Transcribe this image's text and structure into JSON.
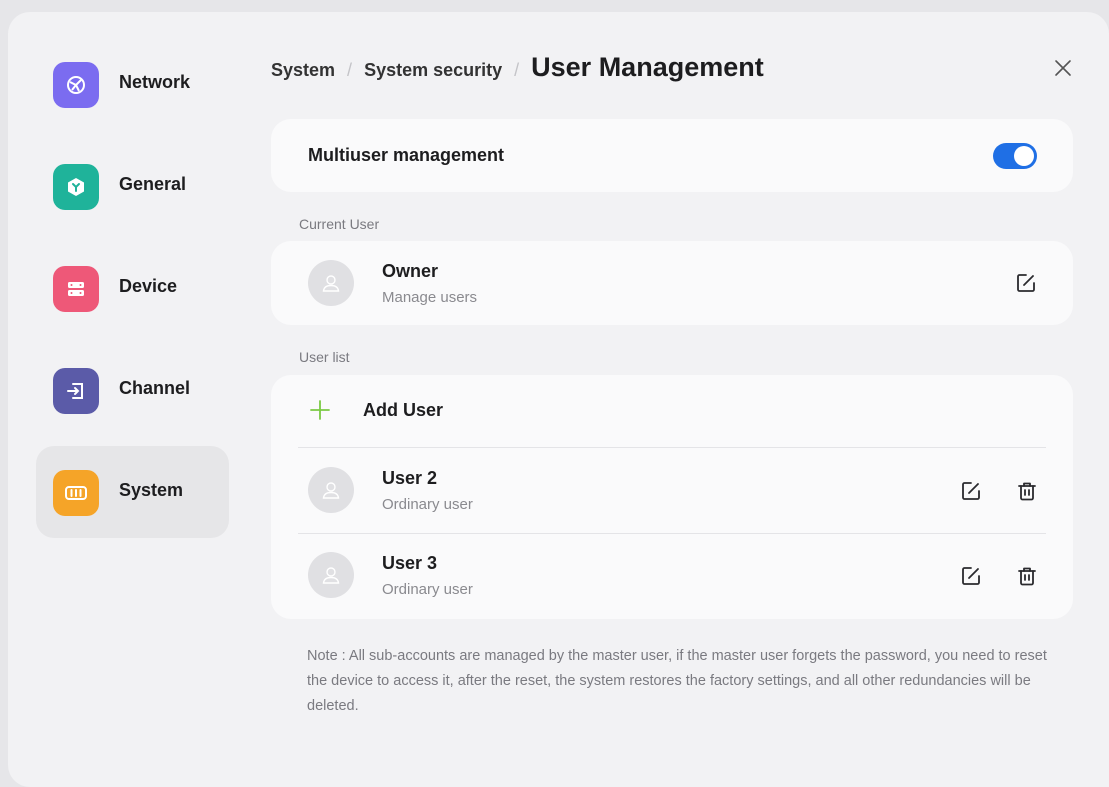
{
  "sidebar": {
    "items": [
      {
        "label": "Network",
        "icon": "network-icon",
        "color": "#7b6cf0"
      },
      {
        "label": "General",
        "icon": "general-icon",
        "color": "#1fb39a"
      },
      {
        "label": "Device",
        "icon": "device-icon",
        "color": "#ee5878"
      },
      {
        "label": "Channel",
        "icon": "channel-icon",
        "color": "#5b5ba8"
      },
      {
        "label": "System",
        "icon": "system-icon",
        "color": "#f5a428",
        "active": true
      }
    ]
  },
  "header": {
    "breadcrumb": [
      "System",
      "System security"
    ],
    "separator": "/",
    "title": "User Management"
  },
  "multiuser": {
    "label": "Multiuser management",
    "enabled": true,
    "toggle_color": "#1f6fe5"
  },
  "current_user": {
    "section_label": "Current User",
    "name": "Owner",
    "role": "Manage users"
  },
  "user_list": {
    "section_label": "User list",
    "add_label": "Add User",
    "add_color": "#7ac943",
    "users": [
      {
        "name": "User 2",
        "role": "Ordinary user"
      },
      {
        "name": "User 3",
        "role": "Ordinary user"
      }
    ]
  },
  "note": "Note : All sub-accounts are managed by the master user, if the master user forgets the password, you need to reset the device to access it, after the reset, the system restores the factory settings, and all other redundancies will be deleted."
}
